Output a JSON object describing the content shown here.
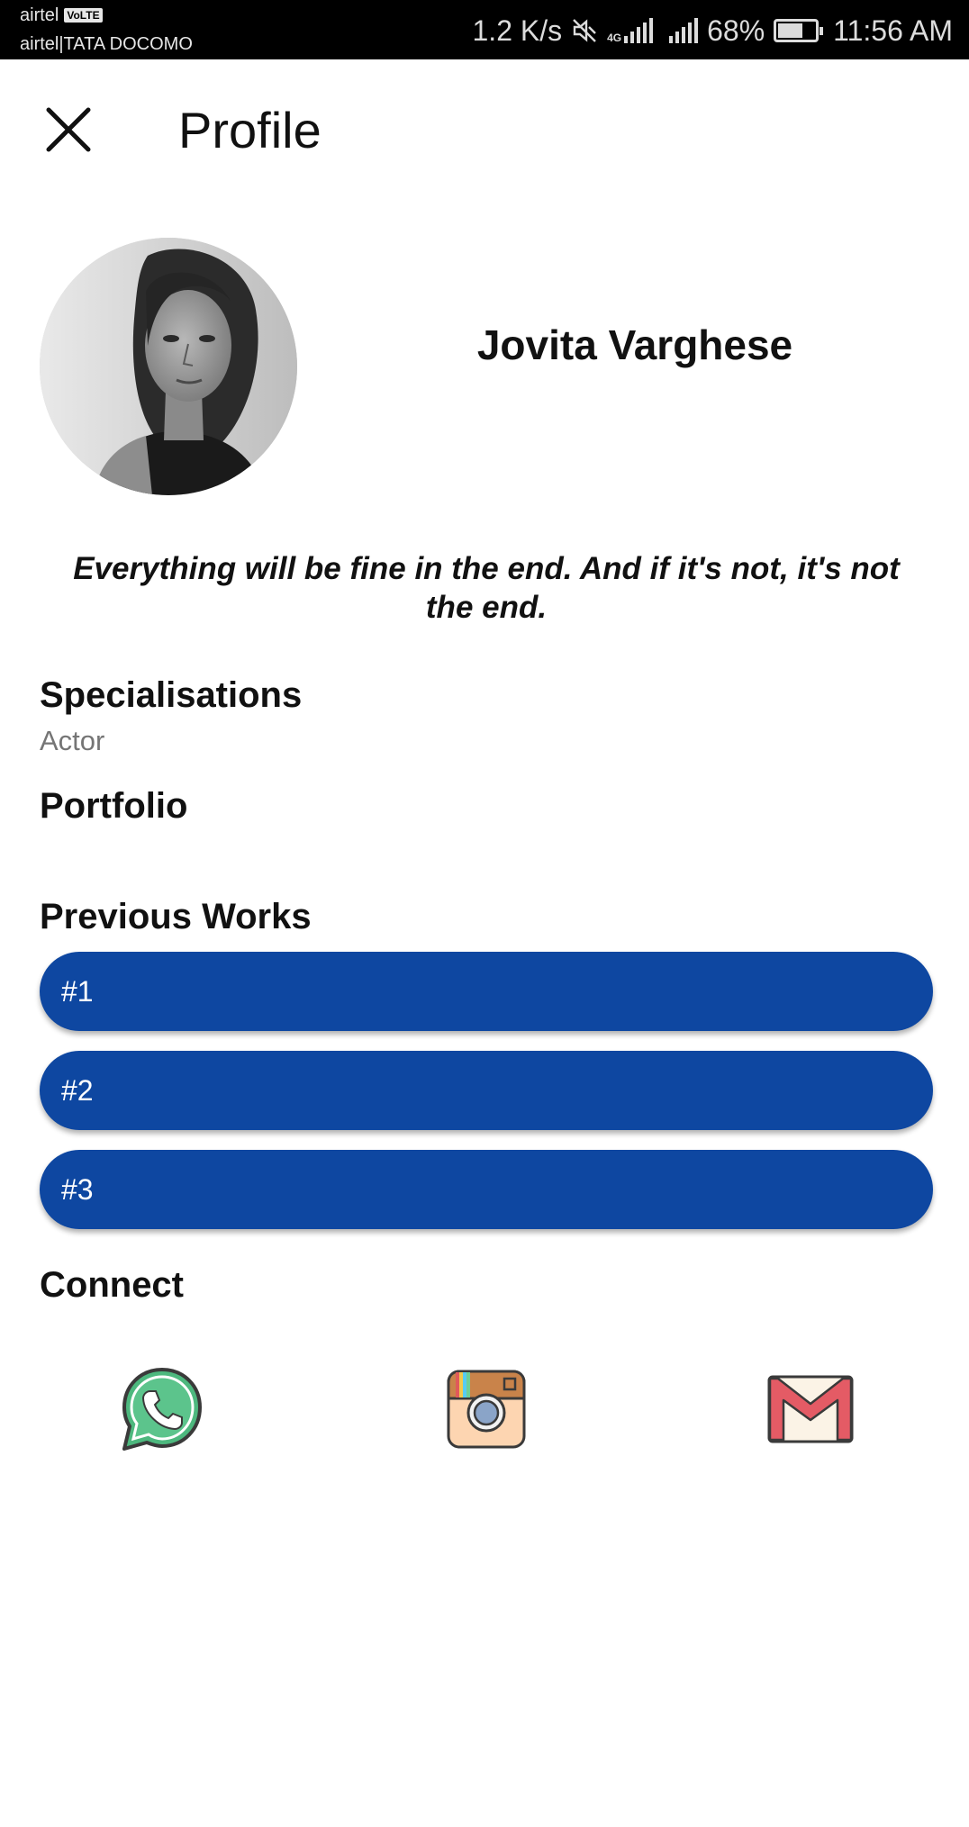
{
  "status_bar": {
    "carrier_primary": "airtel",
    "volte_badge": "VoLTE",
    "carrier_secondary": "airtel|TATA DOCOMO",
    "network_speed": "1.2 K/s",
    "network_type": "4G",
    "battery_percent": "68%",
    "battery_level": 0.68,
    "time": "11:56 AM"
  },
  "header": {
    "close_icon": "close-icon",
    "title": "Profile"
  },
  "profile": {
    "name": "Jovita Varghese",
    "quote": "Everything will be fine in the end. And if it's not, it's not the end."
  },
  "sections": {
    "specialisations_heading": "Specialisations",
    "specialisations_value": "Actor",
    "portfolio_heading": "Portfolio",
    "previous_works_heading": "Previous Works",
    "connect_heading": "Connect"
  },
  "previous_works": [
    "#1",
    "#2",
    "#3"
  ],
  "connect": [
    {
      "icon": "whatsapp-icon"
    },
    {
      "icon": "instagram-icon"
    },
    {
      "icon": "gmail-icon"
    }
  ],
  "colors": {
    "primary_button": "#0e47a1",
    "status_bar": "#000000",
    "muted_text": "#757575"
  }
}
